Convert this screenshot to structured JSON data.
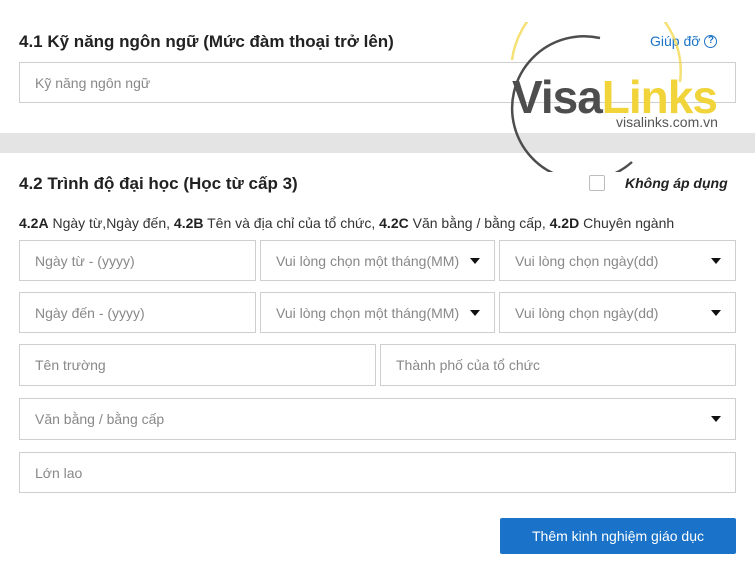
{
  "section_41": {
    "title": "4.1 Kỹ năng ngôn ngữ (Mức đàm thoại trở lên)",
    "help_label": "Giúp đỡ",
    "help_icon": "question-circle-icon",
    "language_placeholder": "Kỹ năng ngôn ngữ"
  },
  "section_42": {
    "title": "4.2 Trình độ đại học (Học từ cấp 3)",
    "not_applicable_label": "Không áp dụng",
    "not_applicable_checked": false,
    "desc": {
      "a_code": "4.2A",
      "a_text": " Ngày từ,Ngày đến, ",
      "b_code": "4.2B",
      "b_text": " Tên và địa chỉ của tổ chức, ",
      "c_code": "4.2C",
      "c_text": " Văn bằng / bằng cấp, ",
      "d_code": "4.2D",
      "d_text": " Chuyên ngành"
    },
    "date_from_year_placeholder": "Ngày từ - (yyyy)",
    "date_from_month_placeholder": "Vui lòng chọn một tháng(MM)",
    "date_from_day_placeholder": "Vui lòng chọn ngày(dd)",
    "date_to_year_placeholder": "Ngày đến - (yyyy)",
    "date_to_month_placeholder": "Vui lòng chọn một tháng(MM)",
    "date_to_day_placeholder": "Vui lòng chọn ngày(dd)",
    "school_placeholder": "Tên trường",
    "city_placeholder": "Thành phố của tổ chức",
    "degree_placeholder": "Văn bằng / bằng cấp",
    "major_value": "Lớn lao",
    "add_button_label": "Thêm kinh nghiệm giáo dục"
  },
  "watermark": {
    "brand_part1": "Visa",
    "brand_part2": "Links",
    "url": "visalinks.com.vn",
    "colors": {
      "dark": "#4d4d4d",
      "accent": "#f1d43a"
    }
  },
  "colors": {
    "primary": "#1a73c8",
    "divider": "#e4e4e4",
    "border": "#cfcfcf"
  }
}
